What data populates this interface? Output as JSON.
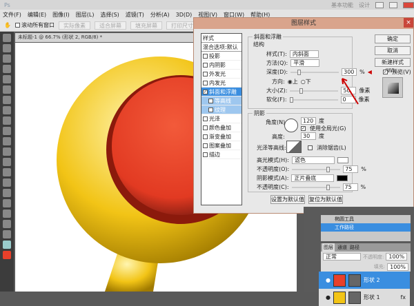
{
  "app": {
    "logo": "Ps",
    "workspace": "基本功能",
    "extra": "设计"
  },
  "menu": [
    "文件(F)",
    "编辑(E)",
    "图像(I)",
    "图层(L)",
    "选择(S)",
    "滤镜(T)",
    "分析(A)",
    "3D(D)",
    "视图(V)",
    "窗口(W)",
    "帮助(H)"
  ],
  "options": {
    "scroll_all": "滚动所有窗口",
    "buttons": [
      "实际像素",
      "适合屏幕",
      "填充屏幕",
      "打印尺寸"
    ]
  },
  "document": {
    "tab": "未标题-1 @ 66.7% (形状 2, RGB/8) *"
  },
  "colors": {
    "accent": "#3a8ee0",
    "red": "#e8402a",
    "yellow": "#f2c416",
    "fg_swatch": "#e8402a"
  },
  "dialog": {
    "title": "图层样式",
    "styles": [
      {
        "label": "样式",
        "type": "header"
      },
      {
        "label": "混合选项:默认",
        "type": "header"
      },
      {
        "label": "投影",
        "checked": false
      },
      {
        "label": "内阴影",
        "checked": false
      },
      {
        "label": "外发光",
        "checked": false
      },
      {
        "label": "内发光",
        "checked": false
      },
      {
        "label": "斜面和浮雕",
        "checked": true,
        "selected": true
      },
      {
        "label": "等高线",
        "checked": false,
        "sub": true
      },
      {
        "label": "纹理",
        "checked": false,
        "sub": true
      },
      {
        "label": "光泽",
        "checked": false
      },
      {
        "label": "颜色叠加",
        "checked": false
      },
      {
        "label": "渐变叠加",
        "checked": false
      },
      {
        "label": "图案叠加",
        "checked": false
      },
      {
        "label": "描边",
        "checked": false
      }
    ],
    "bevel": {
      "group": "斜面和浮雕",
      "structure": "结构",
      "style_label": "样式(T):",
      "style_value": "内斜面",
      "technique_label": "方法(Q):",
      "technique_value": "平滑",
      "depth_label": "深度(D):",
      "depth_value": "300",
      "depth_unit": "%",
      "direction_label": "方向:",
      "dir_up": "上",
      "dir_down": "下",
      "size_label": "大小(Z):",
      "size_value": "50",
      "size_unit": "像素",
      "soften_label": "软化(F):",
      "soften_value": "0",
      "soften_unit": "像素"
    },
    "shading": {
      "group": "阴影",
      "angle_label": "角度(N):",
      "angle_value": "120",
      "angle_unit": "度",
      "global_light": "使用全局光(G)",
      "altitude_label": "高度:",
      "altitude_value": "30",
      "altitude_unit": "度",
      "gloss_label": "光泽等高线:",
      "antialias": "消除锯齿(L)",
      "highlight_label": "高光模式(H):",
      "highlight_value": "滤色",
      "hl_opacity_label": "不透明度(O):",
      "hl_opacity": "75",
      "pct": "%",
      "shadow_label": "阴影模式(A):",
      "shadow_value": "正片叠底",
      "sh_opacity_label": "不透明度(C):",
      "sh_opacity": "75"
    },
    "set_default": "设置为默认值",
    "reset_default": "复位为默认值",
    "ok": "确定",
    "cancel": "取消",
    "new_style": "新建样式(W)...",
    "preview": "预览(V)"
  },
  "paths": [
    {
      "name": "椭圆工具"
    },
    {
      "name": "工作路径",
      "selected": true
    }
  ],
  "layers": {
    "tabs": [
      "图层",
      "通道",
      "路径"
    ],
    "blend": "正常",
    "opacity_label": "不透明度:",
    "opacity": "100%",
    "fill_label": "填充:",
    "fill": "100%",
    "items": [
      {
        "name": "形状 2",
        "selected": true,
        "color": "#e8402a"
      },
      {
        "name": "形状 1",
        "selected": false,
        "color": "#f2c416",
        "fx": "fx"
      }
    ]
  }
}
